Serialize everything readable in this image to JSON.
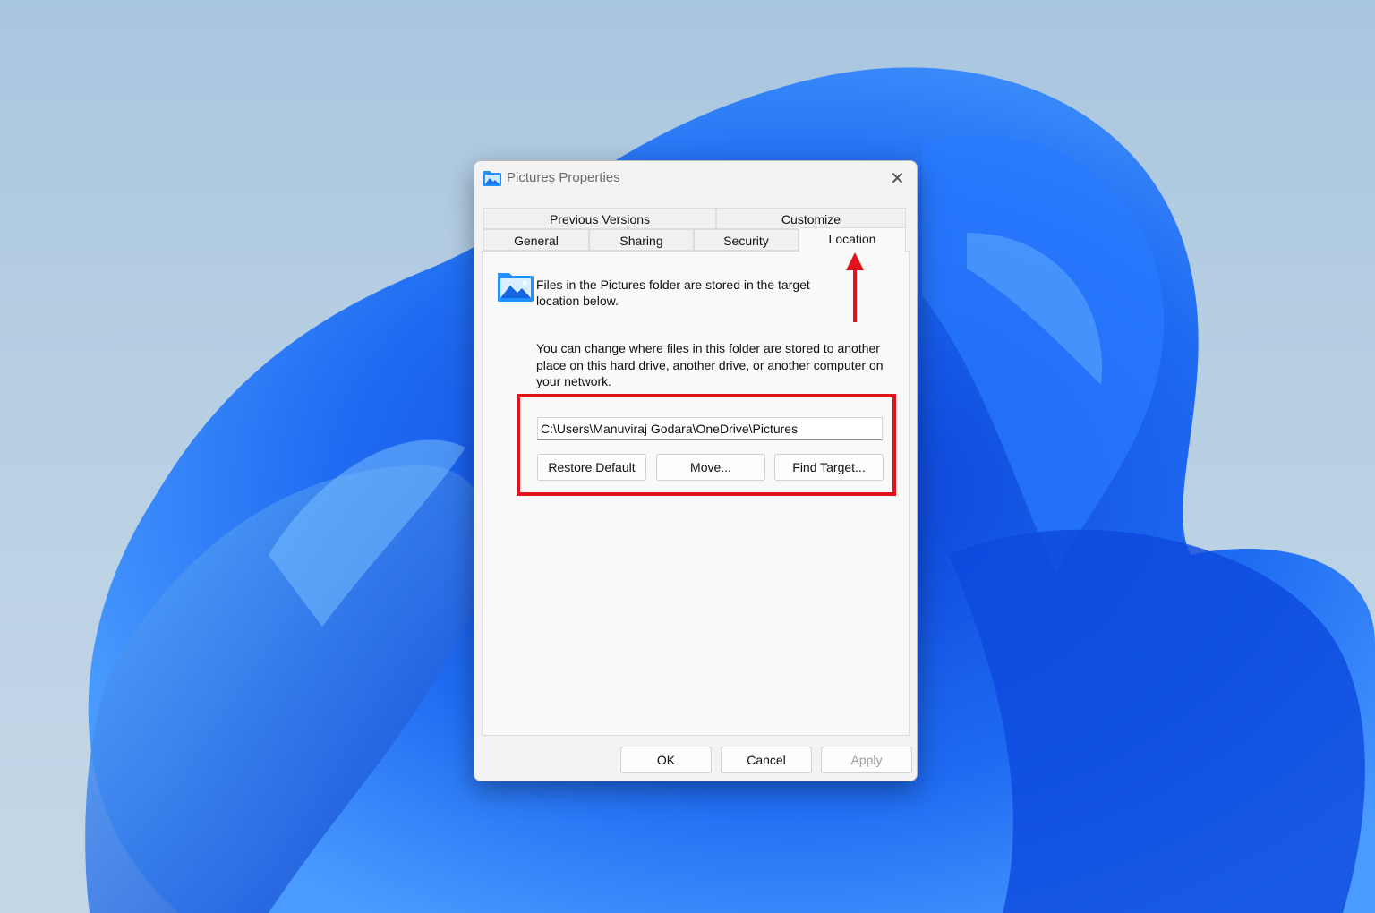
{
  "window": {
    "title": "Pictures Properties",
    "title_icon": "pictures-folder-icon",
    "close_icon": "close-icon",
    "close_glyph": "✕"
  },
  "tabs": {
    "row1": [
      "Previous Versions",
      "Customize"
    ],
    "row2": [
      "General",
      "Sharing",
      "Security",
      "Location"
    ],
    "active": "Location"
  },
  "location_tab": {
    "intro": "Files in the Pictures folder are stored in the target location below.",
    "explanation": "You can change where files in this folder are stored to another place on this hard drive, another drive, or another computer on your network.",
    "path_value": "C:\\Users\\Manuviraj Godara\\OneDrive\\Pictures",
    "buttons": {
      "restore_default": "Restore Default",
      "move": "Move...",
      "find_target": "Find Target..."
    }
  },
  "footer": {
    "ok": "OK",
    "cancel": "Cancel",
    "apply": "Apply",
    "apply_enabled": false
  },
  "annotations": {
    "color": "#e0121b",
    "arrow_target": "Location tab",
    "highlight_target": "path field and buttons"
  }
}
